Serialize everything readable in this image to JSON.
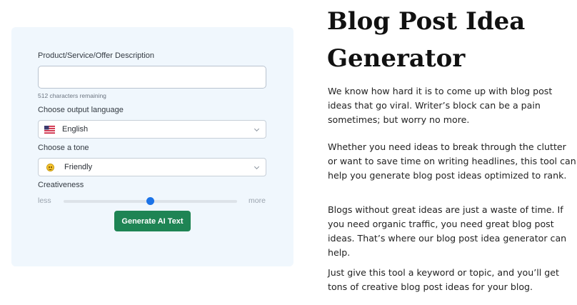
{
  "form": {
    "description_label": "Product/Service/Offer Description",
    "description_value": "",
    "chars_remaining": "512 characters remaining",
    "language_label": "Choose output language",
    "language_value": "English",
    "language_icon": "us-flag-icon",
    "tone_label": "Choose a tone",
    "tone_value": "Friendly",
    "tone_icon": "smiley-face-icon",
    "creativity_label": "Creativeness",
    "creativity_min_label": "less",
    "creativity_max_label": "more",
    "creativity_level": 0.5,
    "generate_button": "Generate AI Text"
  },
  "article": {
    "title": "Blog Post Idea Generator",
    "paragraphs": [
      "We know how hard it is to come up with blog post ideas that go viral. Writer’s block can be a pain sometimes; but worry no more.",
      "Whether you need ideas to break through the clutter or want to save time on writing headlines, this tool can help you generate blog post ideas optimized to rank.",
      "Blogs without great ideas are just a waste of time. If you need organic traffic, you need great blog post ideas. That’s where our blog post idea generator can help.",
      "Just give this tool a keyword or topic, and you’ll get tons of creative blog post ideas for your blog."
    ]
  },
  "colors": {
    "card_background": "#f0f7fd",
    "button": "#1e8454",
    "slider_thumb": "#1b73e8"
  }
}
